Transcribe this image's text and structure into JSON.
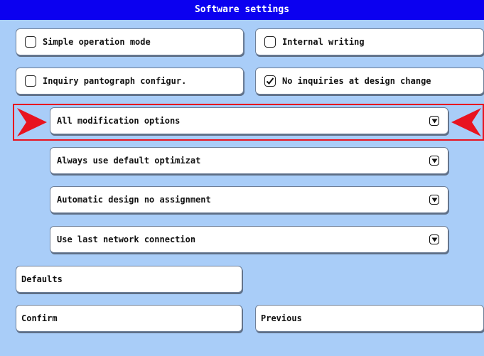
{
  "window": {
    "title": "Software settings"
  },
  "checkboxes": [
    {
      "label": "Simple operation mode",
      "checked": false
    },
    {
      "label": "Internal writing",
      "checked": false
    },
    {
      "label": "Inquiry pantograph configur.",
      "checked": false
    },
    {
      "label": "No inquiries at design change",
      "checked": true
    }
  ],
  "dropdowns": [
    {
      "selected": "All modification options",
      "highlighted": true
    },
    {
      "selected": "Always use default optimizat",
      "highlighted": false
    },
    {
      "selected": "Automatic design no assignment",
      "highlighted": false
    },
    {
      "selected": "Use last network connection",
      "highlighted": false
    }
  ],
  "buttons": {
    "defaults": "Defaults",
    "confirm": "Confirm",
    "previous": "Previous"
  },
  "colors": {
    "background": "#a9cdf8",
    "titlebar": "#0b00f0",
    "highlight": "#e8131f"
  },
  "icons": {
    "dropdown": "chevron-down-icon",
    "marker": "red-triangle-marker-icon",
    "check": "checkmark-icon"
  }
}
